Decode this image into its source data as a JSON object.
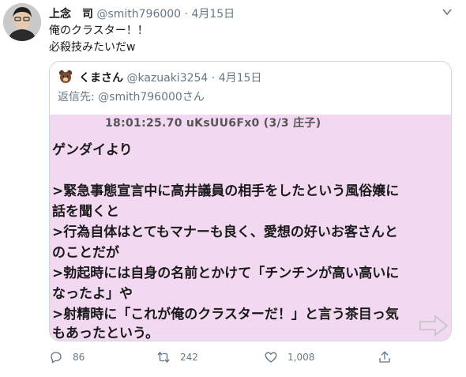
{
  "tweet": {
    "author_name": "上念　司",
    "author_handle": "@smith796000",
    "separator": "·",
    "date": "4月15日",
    "text_lines": [
      "俺のクラスター！！",
      "必殺技みたいだw"
    ]
  },
  "quote": {
    "author_name": "くまさん",
    "author_handle": "@kazuaki3254",
    "separator": "·",
    "date": "4月15日",
    "reply_label": "返信先: ",
    "reply_handle": "@smith796000",
    "reply_suffix": "さん",
    "image": {
      "header": "18:01:25.70 uKsUU6Fx0 (3/3 庄子)",
      "lines": [
        "ゲンダイより",
        "",
        ">緊急事態宣言中に高井議員の相手をしたという風俗嬢に",
        "話を聞くと",
        ">行為自体はとてもマナーも良く、愛想の好いお客さんと",
        "のことだが",
        ">勃起時には自身の名前とかけて「チンチンが高い高いに",
        "なったよ」や",
        ">射精時に「これが俺のクラスターだ！」と言う茶目っ気",
        "もあったという。"
      ]
    }
  },
  "actions": {
    "reply_count": "86",
    "retweet_count": "242",
    "like_count": "1,008"
  },
  "icons": {
    "reply": "reply-icon",
    "retweet": "retweet-icon",
    "like": "heart-icon",
    "share": "share-icon",
    "caret": "chevron-down-icon",
    "arrow": "next-arrow-icon"
  },
  "colors": {
    "secondary_text": "#657786",
    "border": "#ccd6dd",
    "image_background": "#f2d9f1"
  }
}
